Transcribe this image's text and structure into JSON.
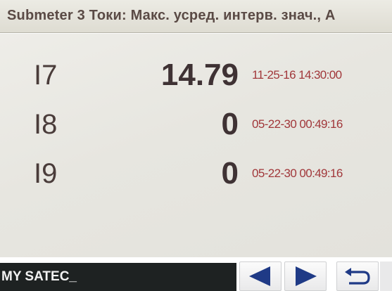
{
  "header": {
    "title": "Submeter 3 Токи: Макс. усред. интерв. знач., А"
  },
  "readings": [
    {
      "label": "I7",
      "value": "14.79",
      "timestamp": "11-25-16 14:30:00"
    },
    {
      "label": "I8",
      "value": "0",
      "timestamp": "05-22-30 00:49:16"
    },
    {
      "label": "I9",
      "value": "0",
      "timestamp": "05-22-30 00:49:16"
    }
  ],
  "footer": {
    "device_name": "MY SATEC_"
  },
  "icons": {
    "prev": "triangle-left-icon",
    "next": "triangle-right-icon",
    "back": "return-arrow-icon"
  },
  "colors": {
    "title_text": "#5a4a45",
    "value_text": "#3f3234",
    "timestamp_text": "#a1373a",
    "nav_icon": "#1f3a86",
    "footer_bg": "#1e2222"
  }
}
